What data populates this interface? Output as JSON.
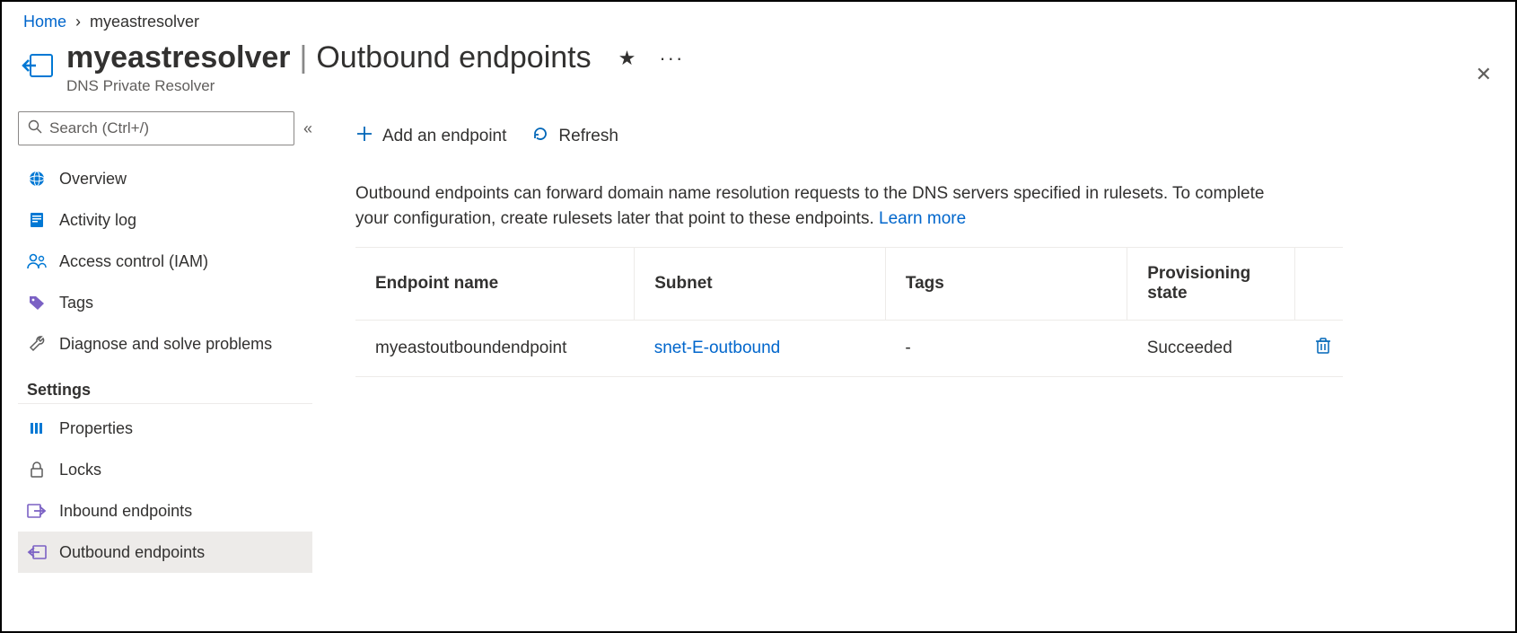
{
  "breadcrumb": {
    "home": "Home",
    "resource": "myeastresolver"
  },
  "header": {
    "resource_name": "myeastresolver",
    "section": "Outbound endpoints",
    "resource_type": "DNS Private Resolver",
    "favorite_glyph": "★",
    "more_glyph": "···"
  },
  "sidebar": {
    "search_placeholder": "Search (Ctrl+/)",
    "items_top": [
      {
        "key": "overview",
        "label": "Overview"
      },
      {
        "key": "activity-log",
        "label": "Activity log"
      },
      {
        "key": "access-control",
        "label": "Access control (IAM)"
      },
      {
        "key": "tags",
        "label": "Tags"
      },
      {
        "key": "diagnose",
        "label": "Diagnose and solve problems"
      }
    ],
    "section_label": "Settings",
    "items_settings": [
      {
        "key": "properties",
        "label": "Properties"
      },
      {
        "key": "locks",
        "label": "Locks"
      },
      {
        "key": "inbound-endpoints",
        "label": "Inbound endpoints"
      },
      {
        "key": "outbound-endpoints",
        "label": "Outbound endpoints"
      }
    ]
  },
  "toolbar": {
    "add_label": "Add an endpoint",
    "refresh_label": "Refresh"
  },
  "description": {
    "text": "Outbound endpoints can forward domain name resolution requests to the DNS servers specified in rulesets. To complete your configuration, create rulesets later that point to these endpoints. ",
    "learn_more": "Learn more"
  },
  "table": {
    "headers": {
      "name": "Endpoint name",
      "subnet": "Subnet",
      "tags": "Tags",
      "state": "Provisioning state"
    },
    "rows": [
      {
        "name": "myeastoutboundendpoint",
        "subnet": "snet-E-outbound",
        "tags": "-",
        "state": "Succeeded"
      }
    ]
  }
}
